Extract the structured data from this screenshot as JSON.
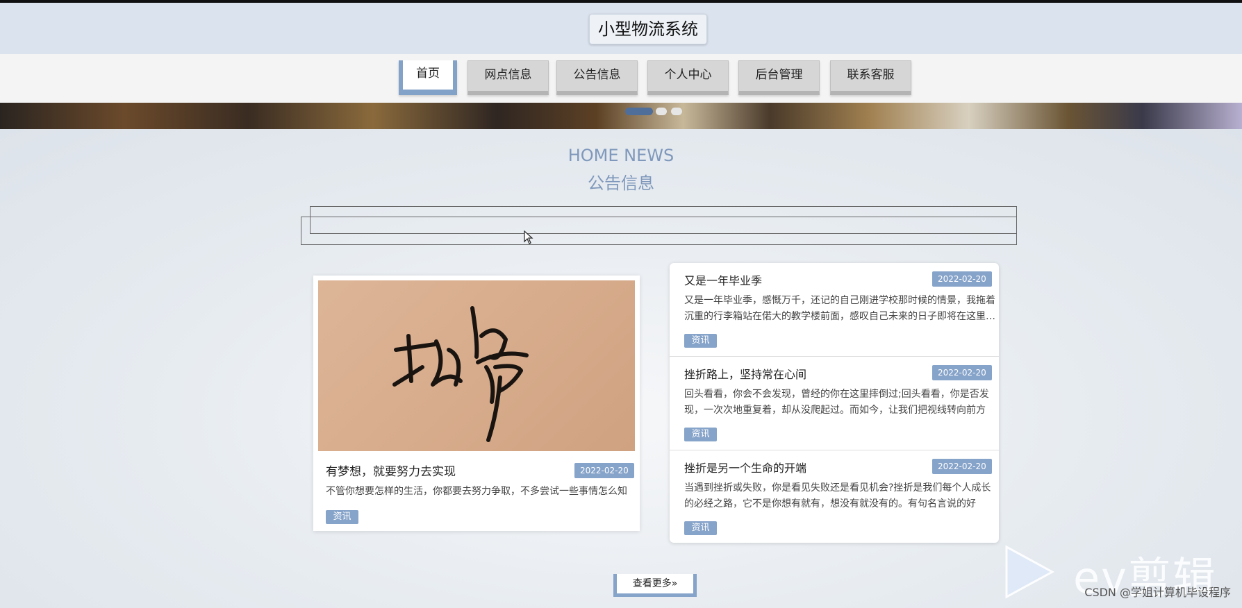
{
  "header": {
    "site_title": "小型物流系统"
  },
  "nav": {
    "items": [
      {
        "label": "首页",
        "active": true
      },
      {
        "label": "网点信息",
        "active": false
      },
      {
        "label": "公告信息",
        "active": false
      },
      {
        "label": "个人中心",
        "active": false
      },
      {
        "label": "后台管理",
        "active": false
      },
      {
        "label": "联系客服",
        "active": false
      }
    ]
  },
  "banner": {
    "slide_count": 3,
    "active_slide": 1
  },
  "section": {
    "title_en": "HOME NEWS",
    "title_zh": "公告信息"
  },
  "featured": {
    "image_text": "故事",
    "title": "有梦想，就要努力去实现",
    "date": "2022-02-20",
    "description": "不管你想要怎样的生活，你都要去努力争取，不多尝试一些事情怎么知",
    "tag": "资讯"
  },
  "news": [
    {
      "title": "又是一年毕业季",
      "date": "2022-02-20",
      "description": "又是一年毕业季，感慨万千，还记的自己刚进学校那时候的情景，我拖着沉重的行李箱站在偌大的教学楼前面，感叹自己未来的日子即将在这里度过",
      "tag": "资讯"
    },
    {
      "title": "挫折路上，坚持常在心间",
      "date": "2022-02-20",
      "description": "回头看看，你会不会发现，曾经的你在这里摔倒过;回头看看，你是否发现，一次次地重复着，却从没爬起过。而如今，让我们把视线转向前方",
      "tag": "资讯"
    },
    {
      "title": "挫折是另一个生命的开端",
      "date": "2022-02-20",
      "description": "当遇到挫折或失败，你是看见失败还是看见机会?挫折是我们每个人成长的必经之路，它不是你想有就有，想没有就没有的。有句名言说的好",
      "tag": "资讯"
    }
  ],
  "more_button": "查看更多»",
  "watermark": {
    "text": "ev剪辑"
  },
  "credit": "CSDN @学姐计算机毕设程序",
  "colors": {
    "accent": "#86a3c9",
    "header_bg": "#dbe3ee",
    "section_title": "#7f98bb"
  }
}
